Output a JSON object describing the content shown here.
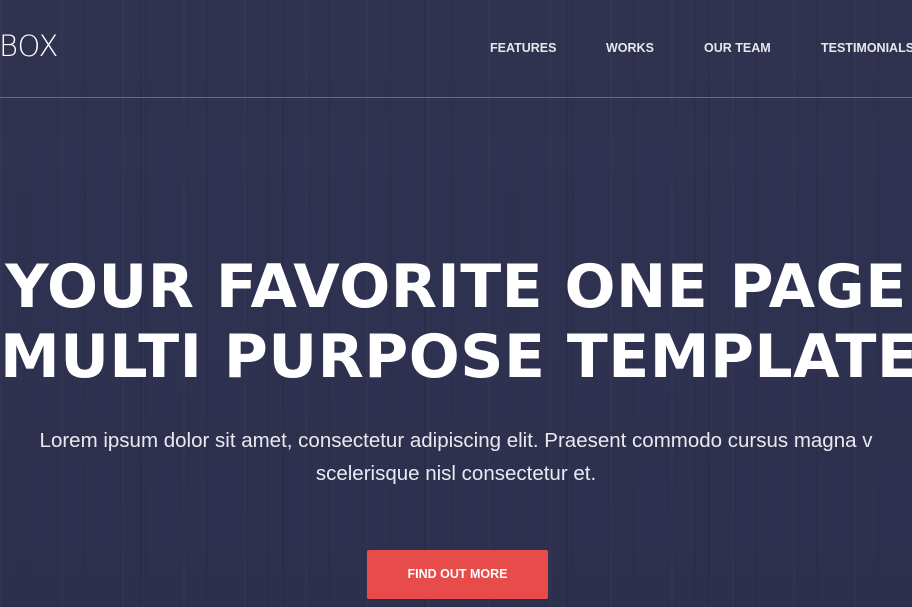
{
  "header": {
    "logo_text": "BOX",
    "nav": [
      {
        "label": "FEATURES"
      },
      {
        "label": "WORKS"
      },
      {
        "label": "OUR TEAM"
      },
      {
        "label": "TESTIMONIALS"
      }
    ]
  },
  "hero": {
    "title_line1": "YOUR FAVORITE ONE PAGE",
    "title_line2": "MULTI PURPOSE TEMPLATE",
    "text_line1": "Lorem ipsum dolor sit amet, consectetur adipiscing elit. Praesent commodo cursus magna v",
    "text_line2": "scelerisque nisl consectetur et.",
    "button_label": "FIND OUT MORE"
  },
  "colors": {
    "background": "#2f3250",
    "accent": "#e74c4a",
    "text": "#ffffff"
  }
}
